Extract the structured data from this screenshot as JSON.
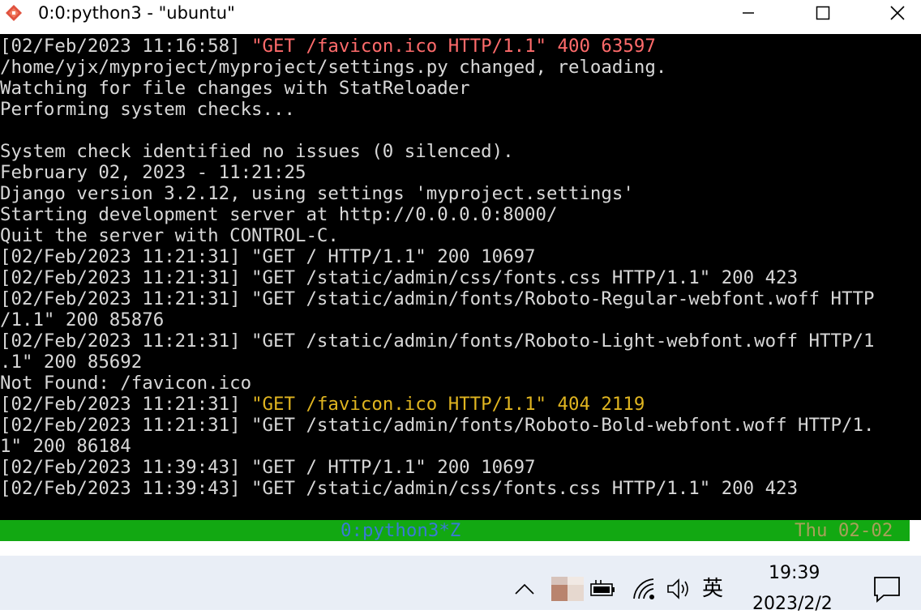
{
  "window": {
    "title": "0:0:python3 - \"ubuntu\""
  },
  "terminal": {
    "lines": [
      {
        "parts": [
          {
            "t": "[02/Feb/2023 11:16:58] ",
            "c": ""
          },
          {
            "t": "\"GET /favicon.ico HTTP/1.1\" 400 63597",
            "c": "red"
          }
        ]
      },
      {
        "parts": [
          {
            "t": "/home/yjx/myproject/myproject/settings.py changed, reloading.",
            "c": ""
          }
        ]
      },
      {
        "parts": [
          {
            "t": "Watching for file changes with StatReloader",
            "c": ""
          }
        ]
      },
      {
        "parts": [
          {
            "t": "Performing system checks...",
            "c": ""
          }
        ]
      },
      {
        "parts": [
          {
            "t": "",
            "c": ""
          }
        ]
      },
      {
        "parts": [
          {
            "t": "System check identified no issues (0 silenced).",
            "c": ""
          }
        ]
      },
      {
        "parts": [
          {
            "t": "February 02, 2023 - 11:21:25",
            "c": ""
          }
        ]
      },
      {
        "parts": [
          {
            "t": "Django version 3.2.12, using settings 'myproject.settings'",
            "c": ""
          }
        ]
      },
      {
        "parts": [
          {
            "t": "Starting development server at http://0.0.0.0:8000/",
            "c": ""
          }
        ]
      },
      {
        "parts": [
          {
            "t": "Quit the server with CONTROL-C.",
            "c": ""
          }
        ]
      },
      {
        "parts": [
          {
            "t": "[02/Feb/2023 11:21:31] \"GET / HTTP/1.1\" 200 10697",
            "c": ""
          }
        ]
      },
      {
        "parts": [
          {
            "t": "[02/Feb/2023 11:21:31] \"GET /static/admin/css/fonts.css HTTP/1.1\" 200 423",
            "c": ""
          }
        ]
      },
      {
        "parts": [
          {
            "t": "[02/Feb/2023 11:21:31] \"GET /static/admin/fonts/Roboto-Regular-webfont.woff HTTP",
            "c": ""
          }
        ]
      },
      {
        "parts": [
          {
            "t": "/1.1\" 200 85876",
            "c": ""
          }
        ]
      },
      {
        "parts": [
          {
            "t": "[02/Feb/2023 11:21:31] \"GET /static/admin/fonts/Roboto-Light-webfont.woff HTTP/1",
            "c": ""
          }
        ]
      },
      {
        "parts": [
          {
            "t": ".1\" 200 85692",
            "c": ""
          }
        ]
      },
      {
        "parts": [
          {
            "t": "Not Found: /favicon.ico",
            "c": ""
          }
        ]
      },
      {
        "parts": [
          {
            "t": "[02/Feb/2023 11:21:31] ",
            "c": ""
          },
          {
            "t": "\"GET /favicon.ico HTTP/1.1\" 404 2119",
            "c": "yellow"
          }
        ]
      },
      {
        "parts": [
          {
            "t": "[02/Feb/2023 11:21:31] \"GET /static/admin/fonts/Roboto-Bold-webfont.woff HTTP/1.",
            "c": ""
          }
        ]
      },
      {
        "parts": [
          {
            "t": "1\" 200 86184",
            "c": ""
          }
        ]
      },
      {
        "parts": [
          {
            "t": "[02/Feb/2023 11:39:43] \"GET / HTTP/1.1\" 200 10697",
            "c": ""
          }
        ]
      },
      {
        "parts": [
          {
            "t": "[02/Feb/2023 11:39:43] \"GET /static/admin/css/fonts.css HTTP/1.1\" 200 423",
            "c": ""
          }
        ]
      }
    ]
  },
  "statusbar": {
    "window_label": "0:python3*Z",
    "right": "Thu 02-02"
  },
  "taskbar": {
    "time": "19:39",
    "date": "2023/2/2",
    "ime": "英",
    "tray_icons": [
      "chevron-up-icon",
      "app-tray-icon",
      "battery-icon",
      "wifi-icon",
      "volume-icon"
    ],
    "notification_icon": "notification-icon"
  },
  "colors": {
    "terminal_bg": "#000000",
    "status_bar": "#12a812",
    "taskbar": "#e9eef6"
  }
}
